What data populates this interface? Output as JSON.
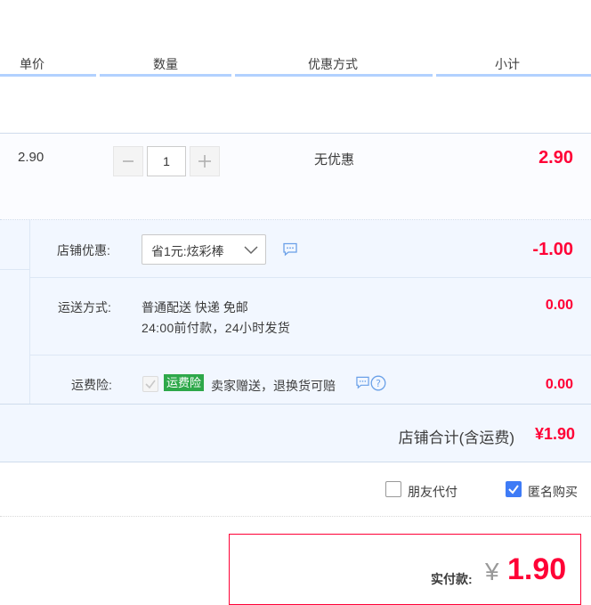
{
  "header": {
    "col_price": "单价",
    "col_qty": "数量",
    "col_promo": "优惠方式",
    "col_subtotal": "小计"
  },
  "item": {
    "price": "2.90",
    "quantity": "1",
    "promo": "无优惠",
    "subtotal": "2.90"
  },
  "shop_discount": {
    "label": "店铺优惠:",
    "selected": "省1元:炫彩棒",
    "amount": "-1.00"
  },
  "shipping": {
    "label": "运送方式:",
    "line1": "普通配送 快递 免邮",
    "line2": "24:00前付款，24小时发货",
    "amount": "0.00"
  },
  "insurance": {
    "label": "运费险:",
    "tag": "运费险",
    "text": "卖家赠送，退换货可赔",
    "amount": "0.00",
    "checked": true,
    "disabled": true
  },
  "shop_total": {
    "label": "店铺合计(含运费)",
    "amount": "¥1.90"
  },
  "options": {
    "friend_pay": "朋友代付",
    "friend_pay_checked": false,
    "anonymous": "匿名购买",
    "anonymous_checked": true
  },
  "payment": {
    "label": "实付款:",
    "currency": "¥",
    "amount": "1.90"
  },
  "colors": {
    "price_red": "#ff0036",
    "accent_blue": "#3e7bf6",
    "insurance_green": "#2ea84a"
  },
  "icons": [
    "minus-icon",
    "plus-icon",
    "chevron-down-icon",
    "message-icon",
    "help-icon",
    "check-icon"
  ]
}
